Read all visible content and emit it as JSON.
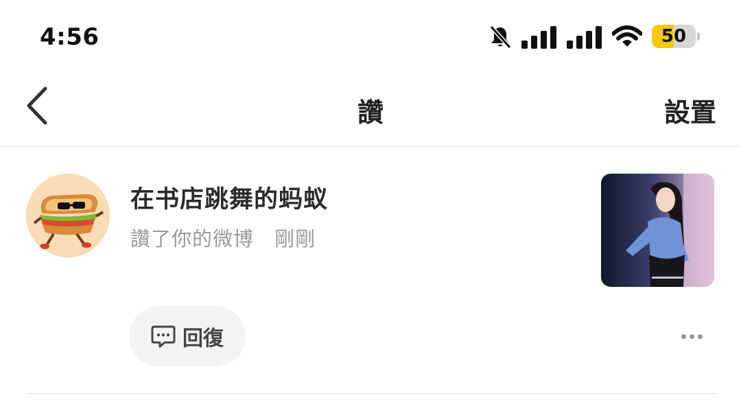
{
  "status_bar": {
    "time": "4:56",
    "battery_level": "50",
    "battery_fraction": 0.5,
    "battery_color": "#f6c90e",
    "icons": [
      "silent-bell-icon",
      "signal-bars-icon",
      "signal-bars-icon",
      "wifi-icon",
      "battery-icon"
    ]
  },
  "nav": {
    "title": "讚",
    "right_label": "設置",
    "back_icon": "chevron-left-icon"
  },
  "notification": {
    "username": "在书店跳舞的蚂蚁",
    "action": "讚了你的微博",
    "time": "剛剛",
    "avatar_icon": "sandwich-mascot-avatar",
    "reply_label": "回復",
    "reply_icon": "comment-bubble-icon",
    "more_icon": "more-dots-icon"
  },
  "colors": {
    "accent_yellow": "#f6c90e",
    "secondary_text": "#999999",
    "button_bg": "#f3f3f3"
  }
}
